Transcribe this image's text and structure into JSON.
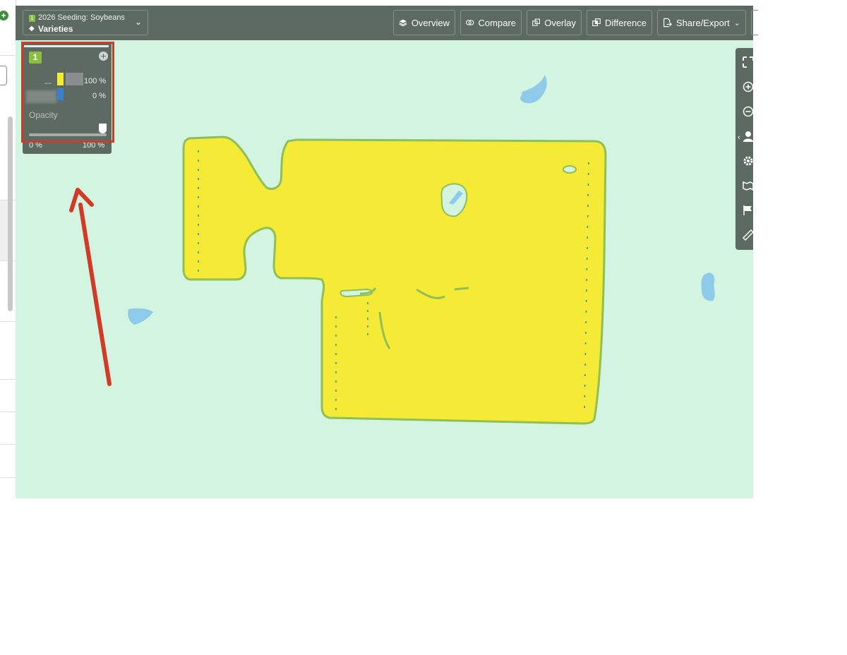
{
  "toolbar": {
    "layer_number": "1",
    "layer_name": "2026 Seeding: Soybeans",
    "layer_sub": "Varieties",
    "buttons": [
      {
        "label": "Overview",
        "icon": "layers-stack-icon"
      },
      {
        "label": "Compare",
        "icon": "compare-circles-icon"
      },
      {
        "label": "Overlay",
        "icon": "overlay-squares-icon"
      },
      {
        "label": "Difference",
        "icon": "difference-squares-icon"
      },
      {
        "label": "Share/Export",
        "icon": "share-export-icon"
      }
    ]
  },
  "legend": {
    "layer_number": "1",
    "dash": "---",
    "rows": [
      {
        "color": "#f5ea36",
        "percent": "100 %"
      },
      {
        "color": "#3a7ed0",
        "percent": "0 %"
      }
    ],
    "opacity_label": "Opacity",
    "opacity_min": "0 %",
    "opacity_max": "100 %",
    "opacity_value": 1.0
  },
  "rail_icons": [
    "fullscreen-icon",
    "zoom-in-icon",
    "zoom-out-icon",
    "user-location-icon",
    "settings-gear-icon",
    "map-fold-icon",
    "flag-icon",
    "ruler-icon"
  ],
  "colors": {
    "toolbar": "#5d6a61",
    "map_background": "#d4f4e2",
    "field_fill": "#f5ea36",
    "field_outline": "#8fbf55",
    "water": "#8ecbea",
    "annotation": "#d13b26"
  }
}
